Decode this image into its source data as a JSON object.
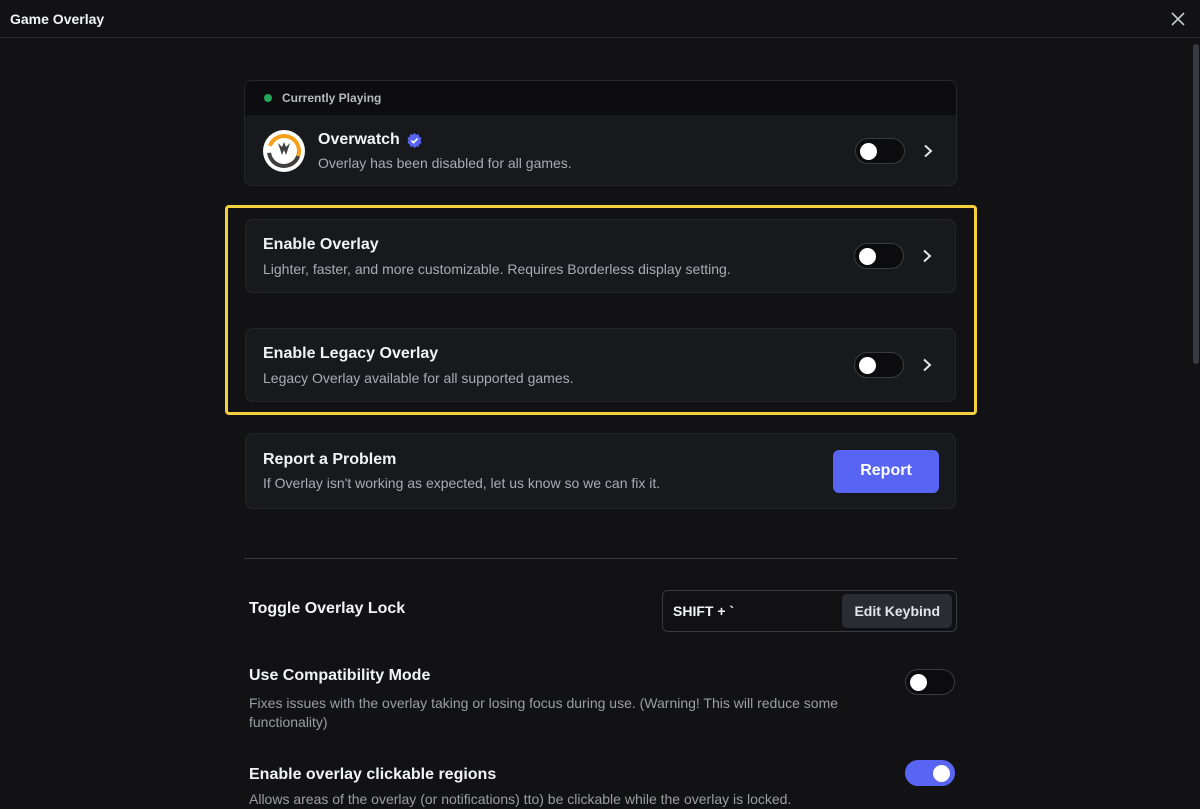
{
  "window": {
    "title": "Game Overlay"
  },
  "now_playing": {
    "header": "Currently Playing",
    "game_name": "Overwatch",
    "game_status": "Overlay has been disabled for all games.",
    "toggle_on": false
  },
  "options": [
    {
      "title": "Enable Overlay",
      "description": "Lighter, faster, and more customizable. Requires Borderless display setting.",
      "toggle_on": false
    },
    {
      "title": "Enable Legacy Overlay",
      "description": "Legacy Overlay available for all supported games.",
      "toggle_on": false
    }
  ],
  "report": {
    "title": "Report a Problem",
    "description": "If Overlay isn't working as expected, let us know so we can fix it.",
    "button_label": "Report"
  },
  "settings": {
    "toggle_lock": {
      "title": "Toggle Overlay Lock",
      "keys": "SHIFT + `",
      "edit_label": "Edit Keybind"
    },
    "compatibility": {
      "title": "Use Compatibility Mode",
      "description": "Fixes issues with the overlay taking or losing focus during use. (Warning! This will reduce some functionality)",
      "toggle_on": false
    },
    "clickable_regions": {
      "title": "Enable overlay clickable regions",
      "description": "Allows areas of the overlay (or notifications) tto) be clickable while the overlay is locked.",
      "toggle_on": true
    }
  },
  "colors": {
    "accent": "#5865f2",
    "highlight": "#f4d03f",
    "status_green": "#23a55a"
  },
  "icons": {
    "close": "close-icon",
    "verified": "verified-badge-icon",
    "chevron": "chevron-right-icon",
    "game_logo": "overwatch-logo-icon"
  }
}
